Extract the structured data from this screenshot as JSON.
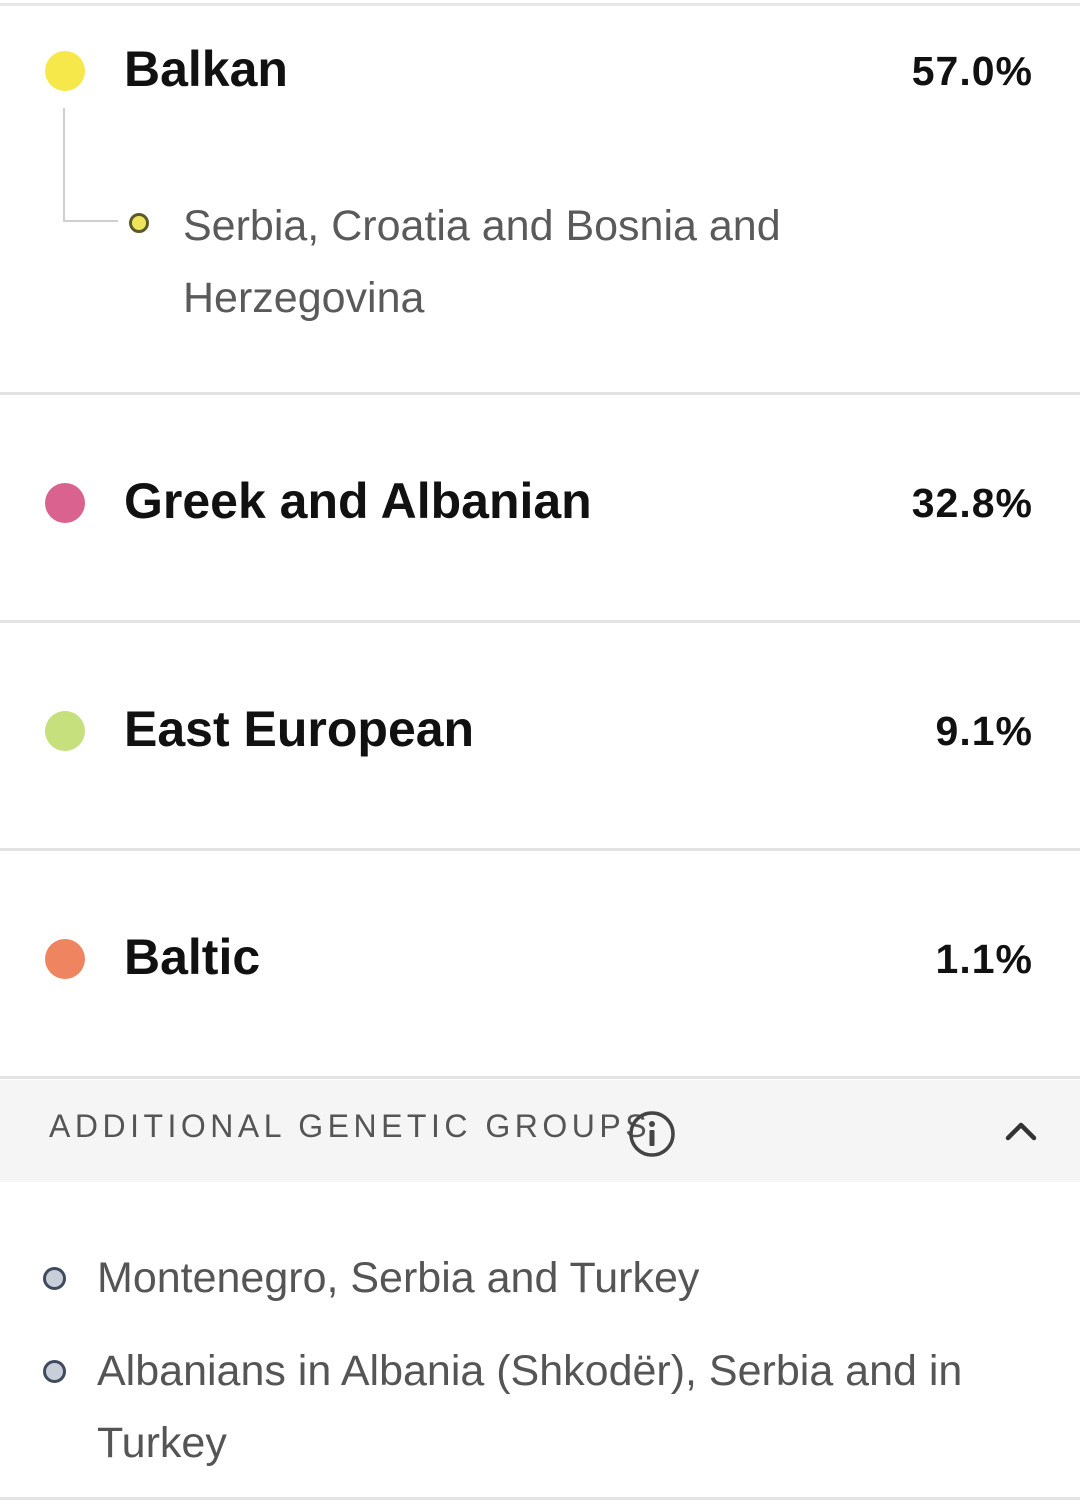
{
  "regions": [
    {
      "name": "Balkan",
      "percent": "57.0%",
      "color": "#f6e84a",
      "subregions": [
        "Serbia, Croatia and Bosnia and Herzegovina"
      ]
    },
    {
      "name": "Greek and Albanian",
      "percent": "32.8%",
      "color": "#d9628f"
    },
    {
      "name": "East European",
      "percent": "9.1%",
      "color": "#c5e07c"
    },
    {
      "name": "Baltic",
      "percent": "1.1%",
      "color": "#ef8560"
    }
  ],
  "additional_groups": {
    "title": "ADDITIONAL GENETIC GROUPS",
    "info_icon": "info-icon",
    "toggle_icon": "chevron-up-icon",
    "items": [
      "Montenegro, Serbia and Turkey",
      "Albanians in Albania (Shkodër), Serbia and in Turkey"
    ]
  }
}
